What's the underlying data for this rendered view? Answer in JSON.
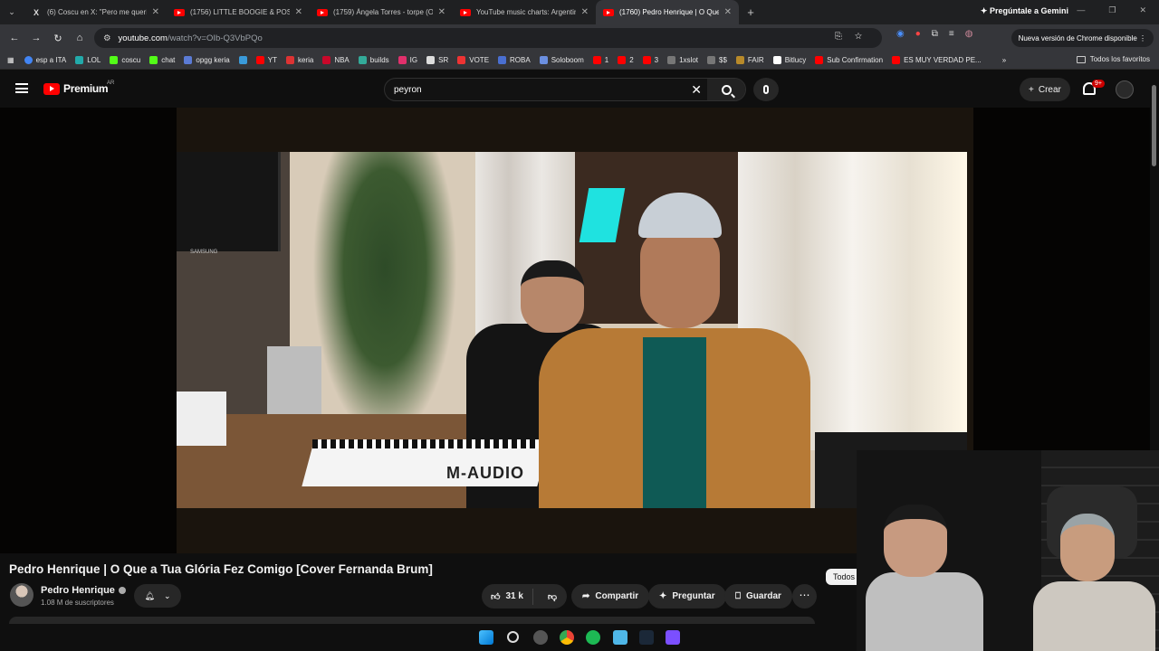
{
  "browser": {
    "tabs": [
      {
        "title": "(6) Coscu en X: \"Pero me quería",
        "favicon": "x-icon"
      },
      {
        "title": "(1756) LITTLE BOOGIE & POST",
        "favicon": "youtube-icon"
      },
      {
        "title": "(1759) Ángela Torres - torpe (O",
        "favicon": "youtube-icon"
      },
      {
        "title": "YouTube music charts: Argentin",
        "favicon": "youtube-icon"
      },
      {
        "title": "(1760) Pedro Henrique | O Que",
        "favicon": "youtube-icon",
        "active": true
      }
    ],
    "gemini_label": "Pregúntale a Gemini",
    "url_host": "youtube.com",
    "url_path": "/watch?v=OIb-Q3VbPQo",
    "update_label": "Nueva versión de Chrome disponible",
    "bookmarks": [
      "esp a ITA",
      "LOL",
      "coscu",
      "chat",
      "opgg keria",
      "",
      "YT",
      "keria",
      "NBA",
      "builds",
      "IG",
      "SR",
      "VOTE",
      "ROBA",
      "Soloboom",
      "1",
      "2",
      "3",
      "1xslot",
      "$$",
      "FAIR",
      "Bitlucy",
      "Sub Confirmation",
      "ES MUY VERDAD PE..."
    ],
    "bookmarks_all": "Todos los favoritos"
  },
  "youtube": {
    "logo_text": "Premium",
    "region": "AR",
    "search_value": "peyron",
    "create_label": "Crear",
    "notif_badge": "9+",
    "video_title": "Pedro Henrique | O Que a Tua Glória Fez Comigo [Cover Fernanda Brum]",
    "channel_name": "Pedro Henrique",
    "subscribers": "1.08 M de suscriptores",
    "likes": "31 k",
    "share_label": "Compartir",
    "ask_label": "Preguntar",
    "save_label": "Guardar",
    "filter_chip": "Todos",
    "video_overlay_text": {
      "tv_brand": "SAMSUNG",
      "keyboard_brand": "M-AUDIO"
    }
  },
  "colors": {
    "accent": "#ff0000",
    "background": "#0f0f0f",
    "chip": "#272727"
  }
}
